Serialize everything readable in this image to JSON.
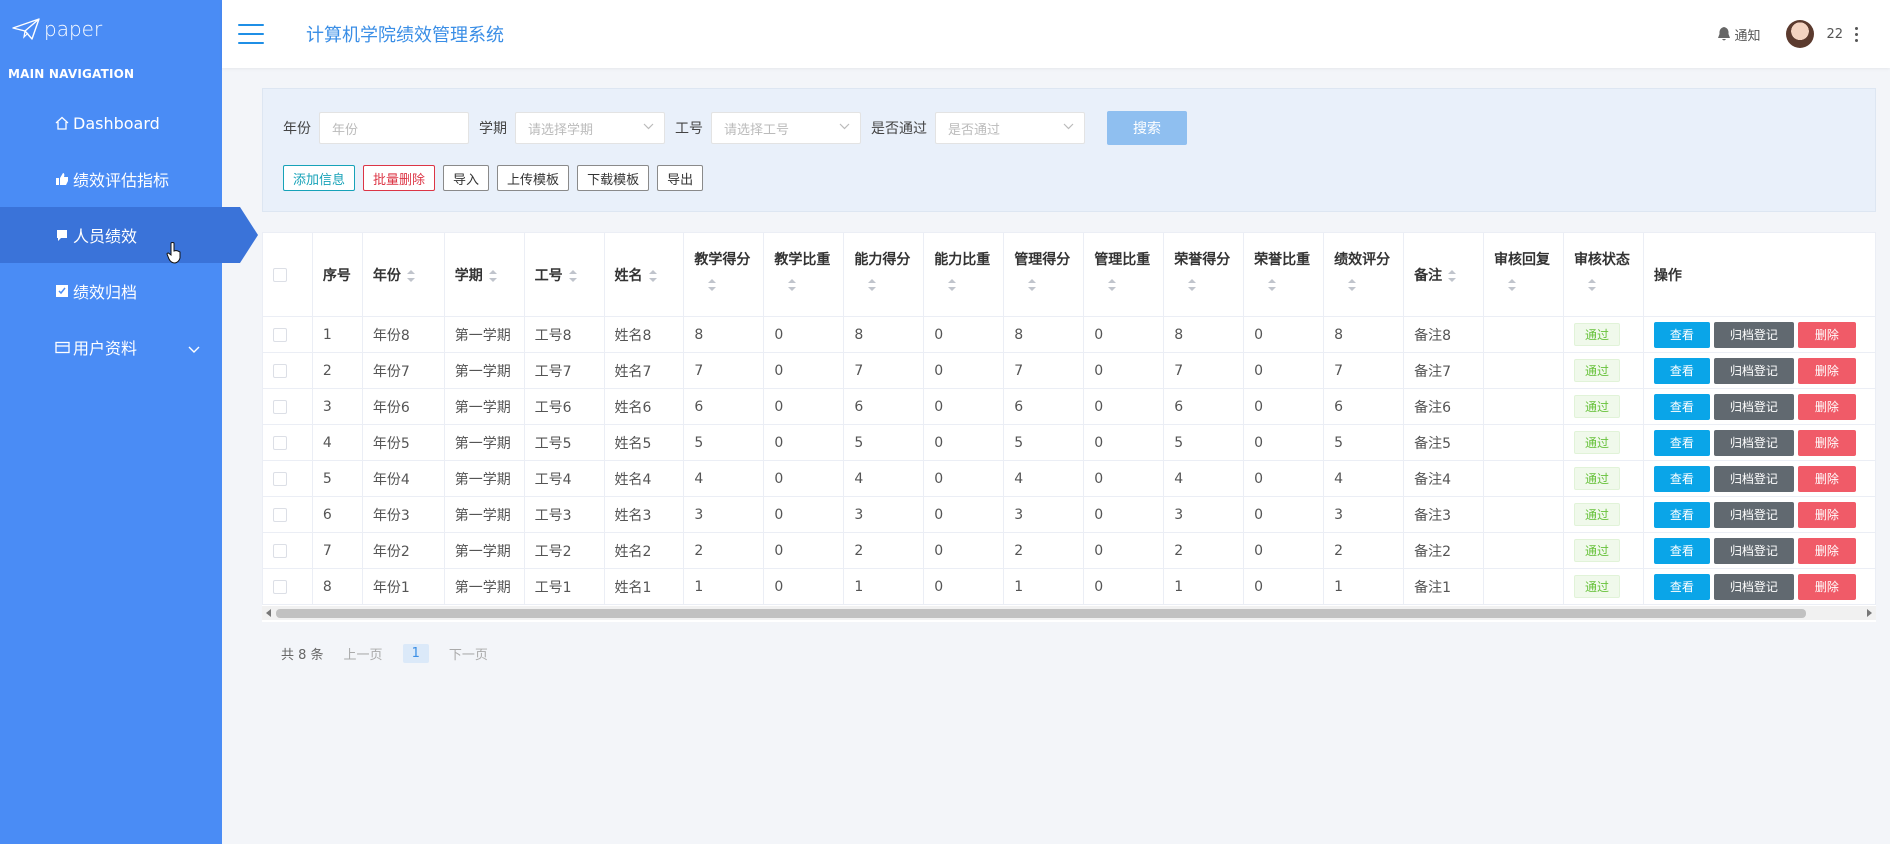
{
  "sidebar": {
    "logo_text": "paper",
    "heading": "MAIN NAVIGATION",
    "items": [
      {
        "label": "Dashboard",
        "icon": "home-icon"
      },
      {
        "label": "绩效评估指标",
        "icon": "thumbs-up-icon"
      },
      {
        "label": "人员绩效",
        "icon": "chat-icon",
        "active": true
      },
      {
        "label": "绩效归档",
        "icon": "check-box-icon"
      },
      {
        "label": "用户资料",
        "icon": "credit-card-icon",
        "expandable": true
      }
    ]
  },
  "header": {
    "title": "计算机学院绩效管理系统",
    "notify_label": "通知",
    "user_name": "22"
  },
  "search": {
    "year_label": "年份",
    "year_placeholder": "年份",
    "term_label": "学期",
    "term_placeholder": "请选择学期",
    "staff_label": "工号",
    "staff_placeholder": "请选择工号",
    "pass_label": "是否通过",
    "pass_placeholder": "是否通过",
    "search_button": "搜索"
  },
  "toolbar": {
    "add": "添加信息",
    "batch_delete": "批量删除",
    "import": "导入",
    "upload_template": "上传模板",
    "download_template": "下载模板",
    "export": "导出"
  },
  "table": {
    "columns": [
      "序号",
      "年份",
      "学期",
      "工号",
      "姓名",
      "教学得分",
      "教学比重",
      "能力得分",
      "能力比重",
      "管理得分",
      "管理比重",
      "荣誉得分",
      "荣誉比重",
      "绩效评分",
      "备注",
      "审核回复",
      "审核状态",
      "操作"
    ],
    "rows": [
      [
        "1",
        "年份8",
        "第一学期",
        "工号8",
        "姓名8",
        "8",
        "0",
        "8",
        "0",
        "8",
        "0",
        "8",
        "0",
        "8",
        "备注8",
        "",
        "通过"
      ],
      [
        "2",
        "年份7",
        "第一学期",
        "工号7",
        "姓名7",
        "7",
        "0",
        "7",
        "0",
        "7",
        "0",
        "7",
        "0",
        "7",
        "备注7",
        "",
        "通过"
      ],
      [
        "3",
        "年份6",
        "第一学期",
        "工号6",
        "姓名6",
        "6",
        "0",
        "6",
        "0",
        "6",
        "0",
        "6",
        "0",
        "6",
        "备注6",
        "",
        "通过"
      ],
      [
        "4",
        "年份5",
        "第一学期",
        "工号5",
        "姓名5",
        "5",
        "0",
        "5",
        "0",
        "5",
        "0",
        "5",
        "0",
        "5",
        "备注5",
        "",
        "通过"
      ],
      [
        "5",
        "年份4",
        "第一学期",
        "工号4",
        "姓名4",
        "4",
        "0",
        "4",
        "0",
        "4",
        "0",
        "4",
        "0",
        "4",
        "备注4",
        "",
        "通过"
      ],
      [
        "6",
        "年份3",
        "第一学期",
        "工号3",
        "姓名3",
        "3",
        "0",
        "3",
        "0",
        "3",
        "0",
        "3",
        "0",
        "3",
        "备注3",
        "",
        "通过"
      ],
      [
        "7",
        "年份2",
        "第一学期",
        "工号2",
        "姓名2",
        "2",
        "0",
        "2",
        "0",
        "2",
        "0",
        "2",
        "0",
        "2",
        "备注2",
        "",
        "通过"
      ],
      [
        "8",
        "年份1",
        "第一学期",
        "工号1",
        "姓名1",
        "1",
        "0",
        "1",
        "0",
        "1",
        "0",
        "1",
        "0",
        "1",
        "备注1",
        "",
        "通过"
      ]
    ],
    "actions": {
      "view": "查看",
      "archive": "归档登记",
      "delete": "删除"
    }
  },
  "pagination": {
    "total": "共 8 条",
    "prev": "上一页",
    "current": "1",
    "next": "下一页"
  },
  "colors": {
    "sidebar": "#4a8cf5",
    "sidebar_active": "#3a73d9",
    "title": "#3a8ee6",
    "view": "#0aa5e8",
    "archive": "#616970",
    "delete": "#f05b68"
  }
}
